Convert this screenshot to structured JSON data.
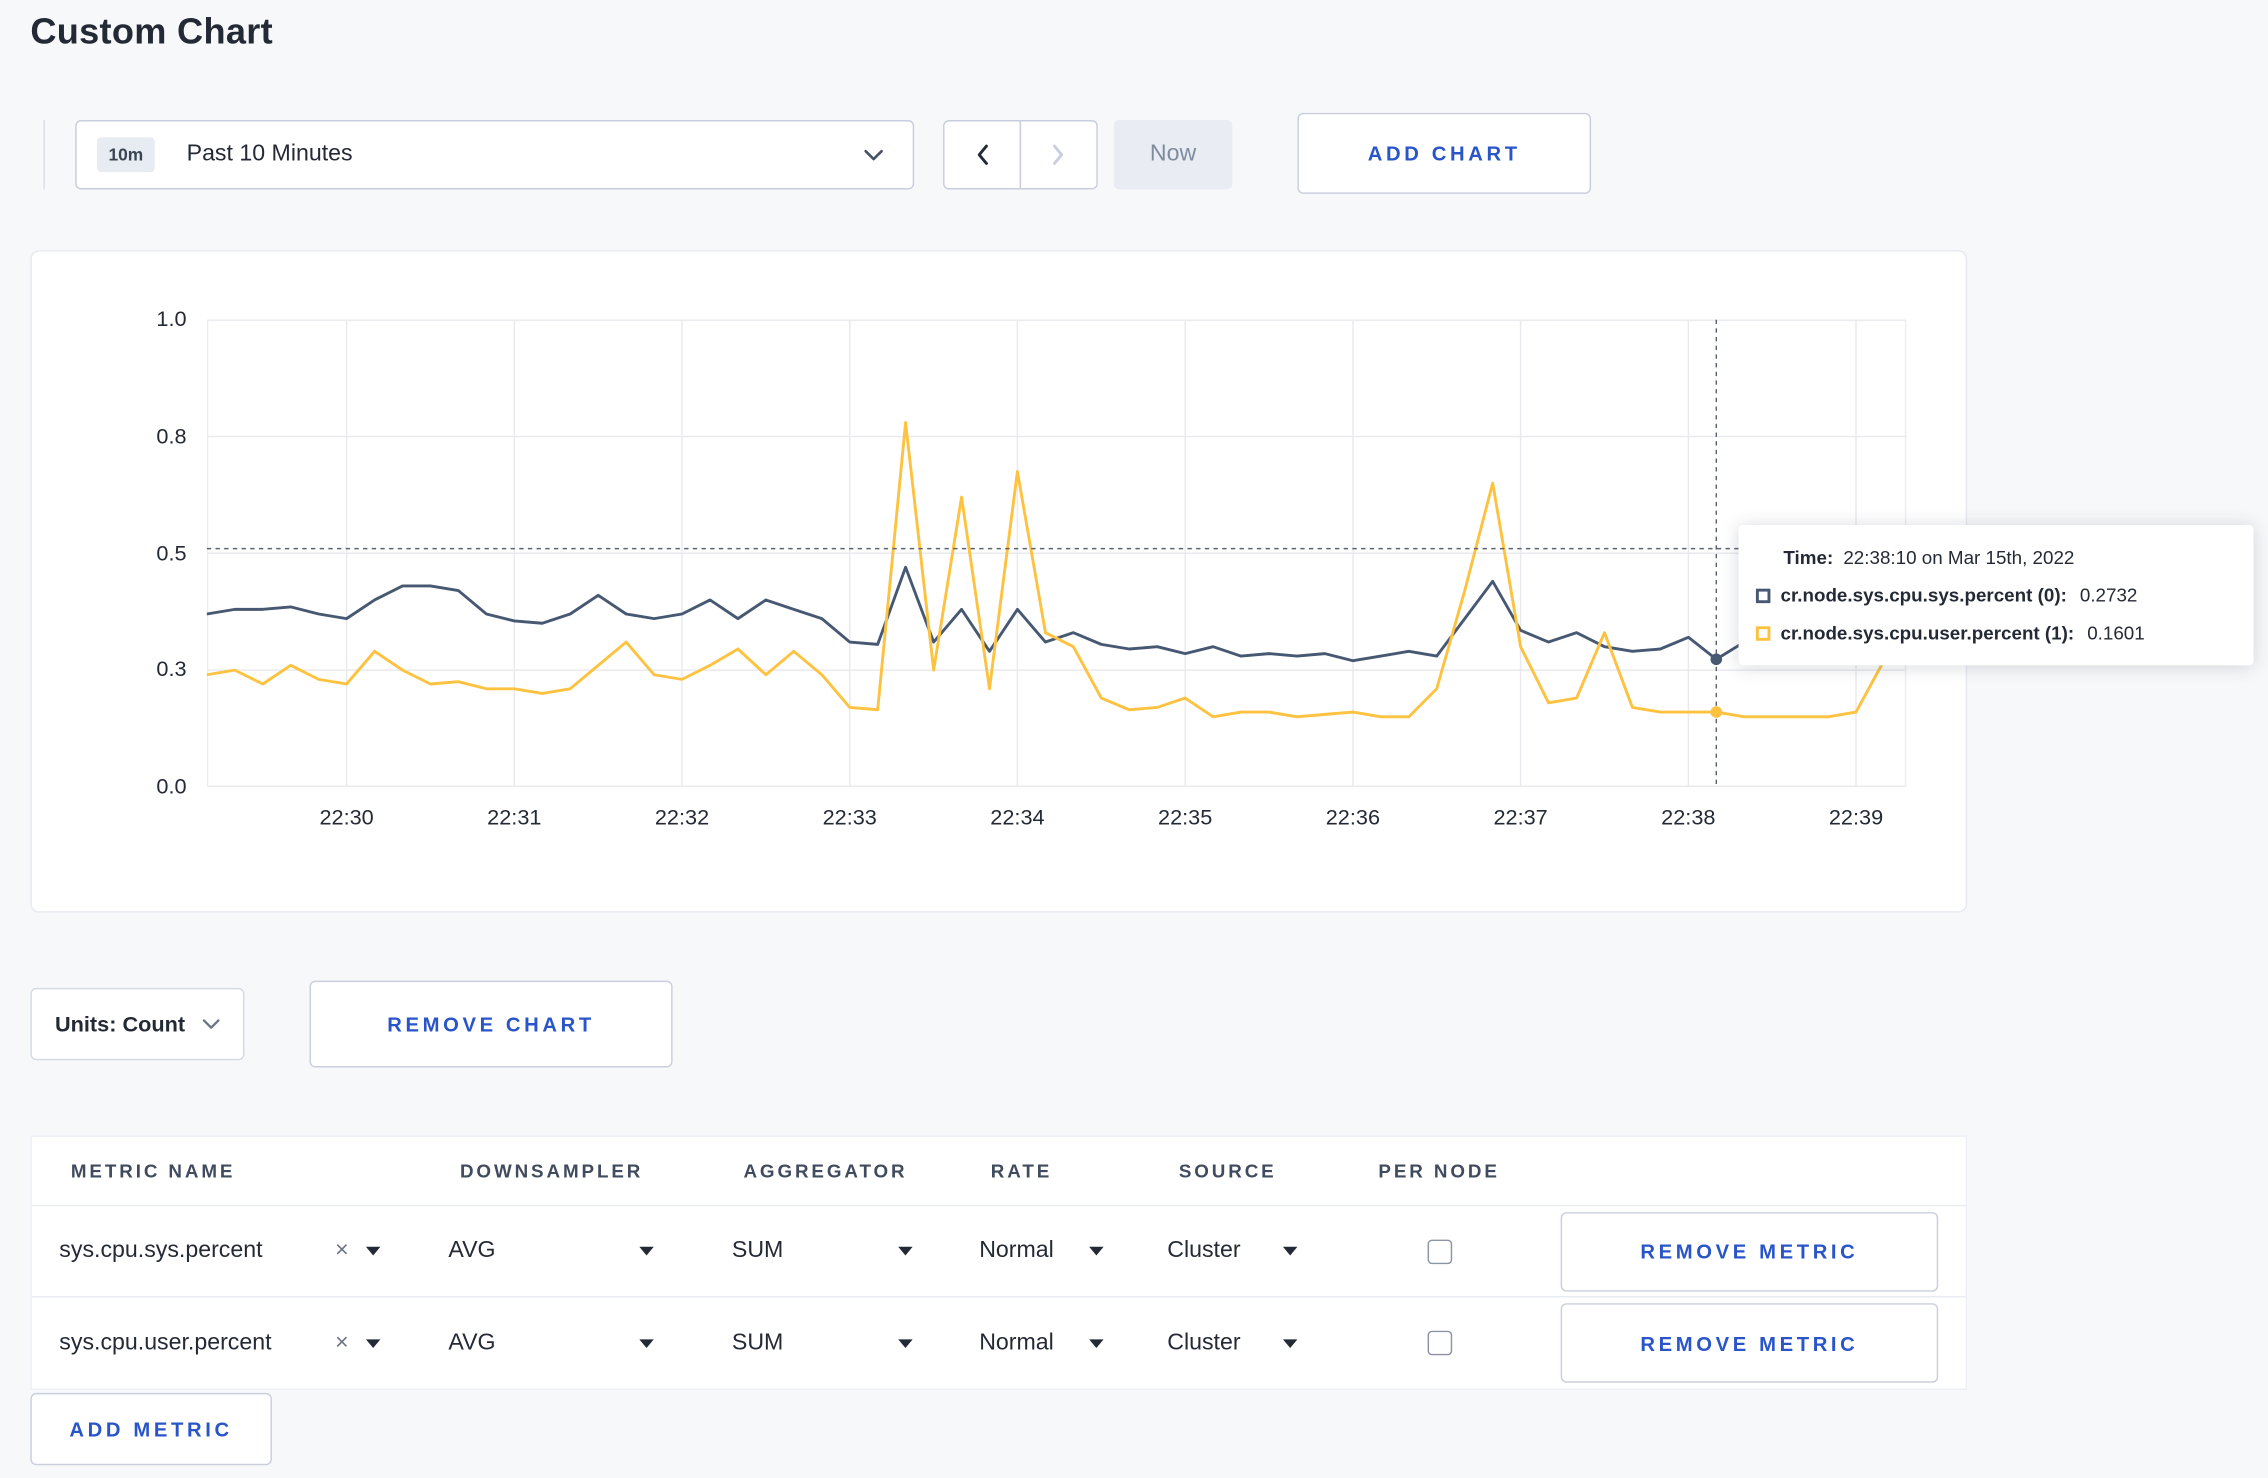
{
  "page": {
    "title": "Custom Chart"
  },
  "colors": {
    "accent": "#2955c9",
    "series_sys": "#475872",
    "series_user": "#fdc240"
  },
  "toolbar": {
    "time_range_badge": "10m",
    "time_range_label": "Past 10 Minutes",
    "now_label": "Now",
    "add_chart_label": "ADD CHART"
  },
  "chart_controls": {
    "units_label": "Units: Count",
    "remove_chart_label": "REMOVE CHART"
  },
  "tooltip": {
    "time_label": "Time:",
    "time_value": "22:38:10 on Mar 15th, 2022",
    "series": [
      {
        "name": "cr.node.sys.cpu.sys.percent (0):",
        "value": "0.2732",
        "color": "#475872"
      },
      {
        "name": "cr.node.sys.cpu.user.percent (1):",
        "value": "0.1601",
        "color": "#fdc240"
      }
    ]
  },
  "metrics_table": {
    "headers": [
      "METRIC NAME",
      "DOWNSAMPLER",
      "AGGREGATOR",
      "RATE",
      "SOURCE",
      "PER NODE"
    ],
    "rows": [
      {
        "metric": "sys.cpu.sys.percent",
        "downsampler": "AVG",
        "aggregator": "SUM",
        "rate": "Normal",
        "source": "Cluster",
        "per_node_checked": false,
        "remove_label": "REMOVE METRIC"
      },
      {
        "metric": "sys.cpu.user.percent",
        "downsampler": "AVG",
        "aggregator": "SUM",
        "rate": "Normal",
        "source": "Cluster",
        "per_node_checked": false,
        "remove_label": "REMOVE METRIC"
      }
    ],
    "add_metric_label": "ADD METRIC"
  },
  "chart_data": {
    "type": "line",
    "title": "",
    "xlabel": "",
    "ylabel": "",
    "ylim": [
      0,
      1
    ],
    "grid": true,
    "y_ticks": [
      {
        "value": 0.0,
        "label": "0.0"
      },
      {
        "value": 0.25,
        "label": "0.3"
      },
      {
        "value": 0.5,
        "label": "0.5"
      },
      {
        "value": 0.75,
        "label": "0.8"
      },
      {
        "value": 1.0,
        "label": "1.0"
      }
    ],
    "x_start_time": "22:29:10",
    "x_interval_seconds": 10,
    "x_domain_seconds": [
      0,
      608
    ],
    "x_ticks": [
      {
        "t": 50,
        "label": "22:30"
      },
      {
        "t": 110,
        "label": "22:31"
      },
      {
        "t": 170,
        "label": "22:32"
      },
      {
        "t": 230,
        "label": "22:33"
      },
      {
        "t": 290,
        "label": "22:34"
      },
      {
        "t": 350,
        "label": "22:35"
      },
      {
        "t": 410,
        "label": "22:36"
      },
      {
        "t": 470,
        "label": "22:37"
      },
      {
        "t": 530,
        "label": "22:38"
      },
      {
        "t": 590,
        "label": "22:39"
      }
    ],
    "series": [
      {
        "name": "cr.node.sys.cpu.sys.percent",
        "color": "#475872",
        "values": [
          0.37,
          0.38,
          0.38,
          0.385,
          0.37,
          0.36,
          0.4,
          0.43,
          0.43,
          0.42,
          0.37,
          0.355,
          0.35,
          0.37,
          0.41,
          0.37,
          0.36,
          0.37,
          0.4,
          0.36,
          0.4,
          0.38,
          0.36,
          0.31,
          0.305,
          0.47,
          0.31,
          0.38,
          0.29,
          0.38,
          0.31,
          0.33,
          0.305,
          0.295,
          0.3,
          0.285,
          0.3,
          0.28,
          0.285,
          0.28,
          0.285,
          0.27,
          0.28,
          0.29,
          0.28,
          0.36,
          0.44,
          0.335,
          0.31,
          0.33,
          0.3,
          0.29,
          0.295,
          0.32,
          0.2732,
          0.31
        ]
      },
      {
        "name": "cr.node.sys.cpu.user.percent",
        "color": "#fdc240",
        "values": [
          0.24,
          0.25,
          0.22,
          0.26,
          0.23,
          0.22,
          0.29,
          0.25,
          0.22,
          0.225,
          0.21,
          0.21,
          0.2,
          0.21,
          0.26,
          0.31,
          0.24,
          0.23,
          0.26,
          0.295,
          0.24,
          0.29,
          0.24,
          0.17,
          0.165,
          0.78,
          0.25,
          0.62,
          0.21,
          0.675,
          0.33,
          0.3,
          0.19,
          0.165,
          0.17,
          0.19,
          0.15,
          0.16,
          0.16,
          0.15,
          0.155,
          0.16,
          0.15,
          0.15,
          0.21,
          0.42,
          0.65,
          0.3,
          0.18,
          0.19,
          0.33,
          0.17,
          0.16,
          0.16,
          0.1601,
          0.15,
          0.15,
          0.15,
          0.15,
          0.16,
          0.27
        ]
      }
    ],
    "crosshair": {
      "t": 540,
      "y": 0.51,
      "highlight": [
        {
          "series": 0,
          "value": 0.2732
        },
        {
          "series": 1,
          "value": 0.1601
        }
      ]
    }
  }
}
